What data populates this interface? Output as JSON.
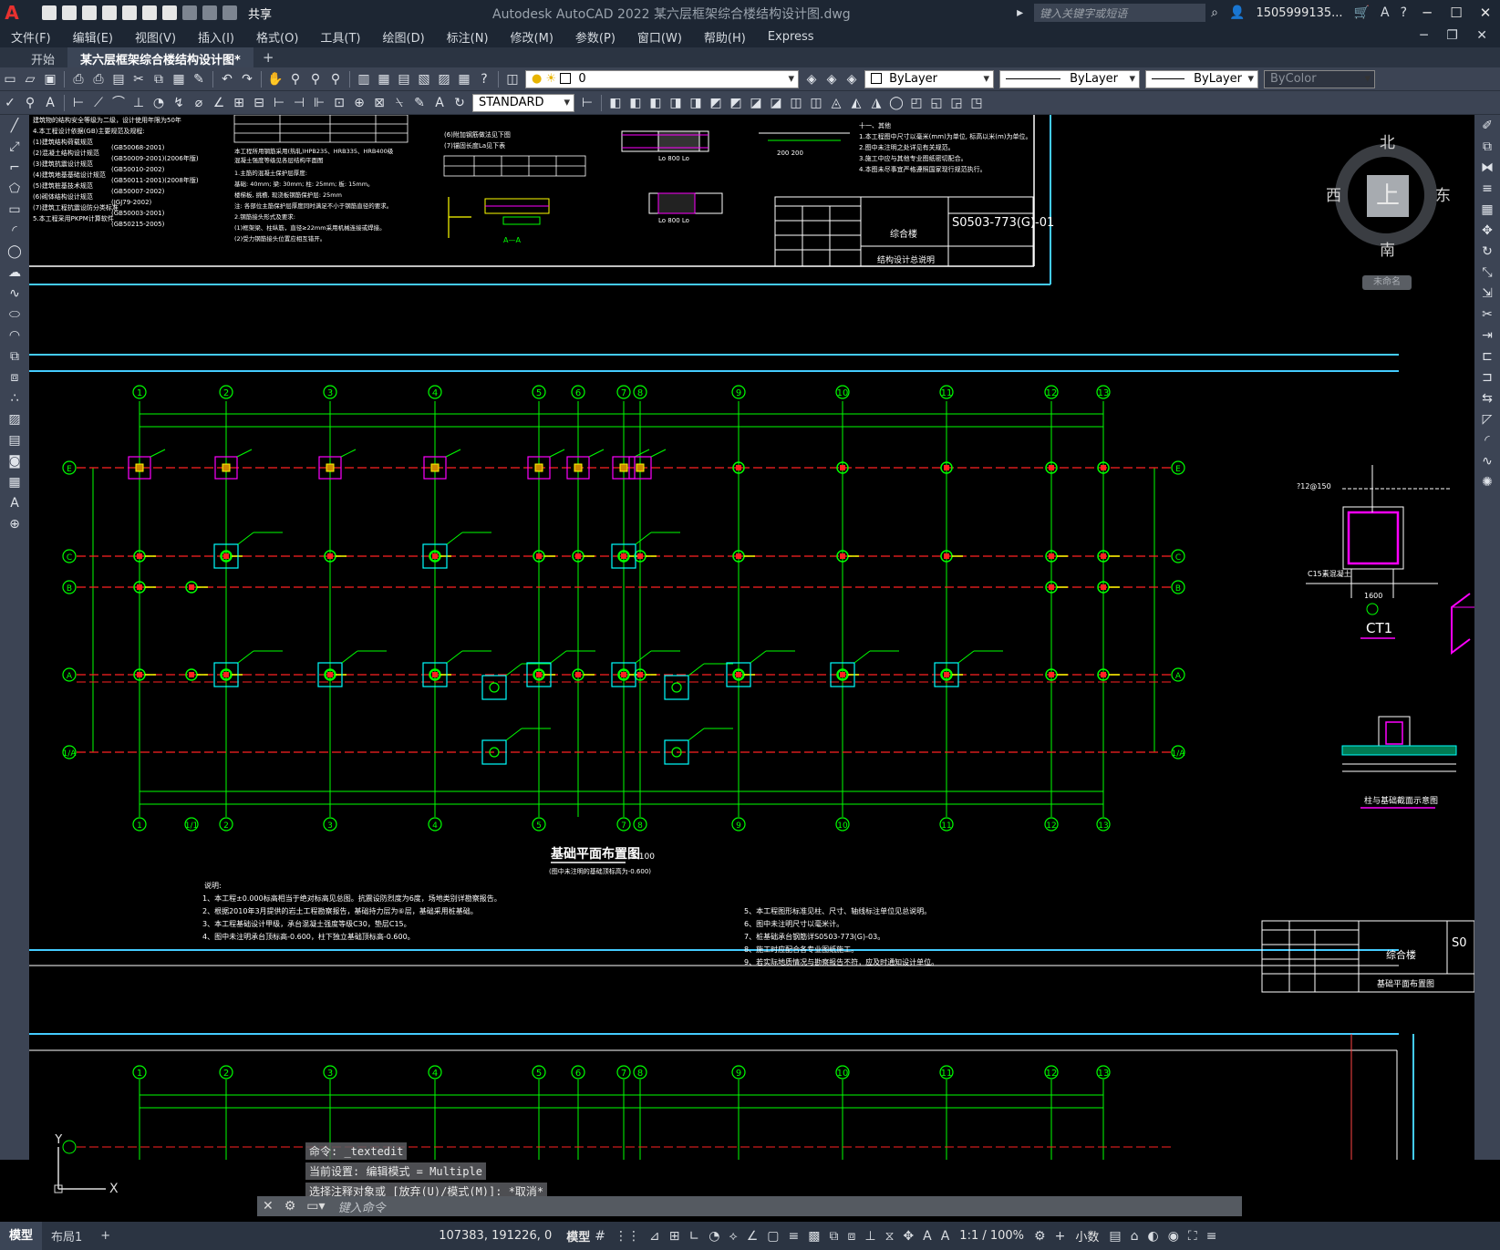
{
  "titlebar": {
    "app_title": "Autodesk AutoCAD 2022    某六层框架综合楼结构设计图.dwg",
    "share_label": "共享",
    "search_placeholder": "键入关键字或短语",
    "user": "1505999135...",
    "icons": [
      "autocad-logo",
      "new-icon",
      "open-icon",
      "save-icon",
      "saveas-icon",
      "plot-icon",
      "undo-icon",
      "redo-icon",
      "search-icon",
      "user-icon",
      "cart-icon",
      "help-icon"
    ]
  },
  "menu": {
    "items": [
      "文件(F)",
      "编辑(E)",
      "视图(V)",
      "插入(I)",
      "格式(O)",
      "工具(T)",
      "绘图(D)",
      "标注(N)",
      "修改(M)",
      "参数(P)",
      "窗口(W)",
      "帮助(H)",
      "Express"
    ]
  },
  "tabs": {
    "start": "开始",
    "active": "某六层框架综合楼结构设计图*",
    "add": "+"
  },
  "toolbar1": {
    "layer_value": "0",
    "color_value": "ByLayer",
    "linetype_value": "ByLayer",
    "lineweight_value": "ByLayer",
    "plotstyle_value": "ByColor"
  },
  "toolbar2": {
    "textstyle_value": "STANDARD"
  },
  "drawing": {
    "plan_title": "基础平面布置图",
    "plan_scale": "1:100",
    "plan_subtitle": "(图中未注明的基础顶标高为-0.600)",
    "sheet_code": "S0503-773(G)-01",
    "project_name": "综合楼",
    "sheet_name_top": "结构设计总说明",
    "sheet_name_bottom": "基础平面布置图",
    "detail_ct1": "CT1",
    "detail_section": "柱与基础截面示意图",
    "notes_header": "说明:",
    "notes": [
      "1、本工程±0.000标高相当于绝对标高见总图。抗震设防烈度为6度，场地类别详勘察报告。",
      "2、根据2010年3月提供的岩土工程勘察报告，基础持力层为⑥层，基础采用桩基础。",
      "3、本工程基础设计甲级，承台混凝土强度等级C30，垫层C15。",
      "4、图中未注明承台顶标高-0.600，柱下独立基础顶标高-0.600。"
    ],
    "notes_right": [
      "5、本工程图形标准见柱、尺寸、轴线标注单位见总说明。",
      "6、图中未注明尺寸以毫米计。",
      "7、桩基础承台钢筋详S0503-773(G)-03。",
      "8、施工时应配合各专业图纸施工。",
      "9、若实际地质情况与勘察报告不符，应及时通知设计单位。"
    ],
    "axis_top": [
      "1",
      "2",
      "3",
      "4",
      "5",
      "6",
      "7",
      "8",
      "9",
      "10",
      "11",
      "12",
      "13"
    ],
    "axis_bottom": [
      "1",
      "1/1",
      "2",
      "3",
      "4",
      "5",
      "7",
      "8",
      "9",
      "10",
      "11",
      "12",
      "13"
    ],
    "axis_rows": [
      "E",
      "C",
      "B",
      "A",
      "2/A",
      "1/A"
    ]
  },
  "viewcube": {
    "north": "北",
    "south": "南",
    "east": "东",
    "west": "西",
    "face": "上",
    "named_view": "未命名"
  },
  "command": {
    "history": [
      "命令:  _textedit",
      "当前设置: 编辑模式 = Multiple",
      "选择注释对象或 [放弃(U)/模式(M)]: *取消*"
    ],
    "placeholder": "键入命令"
  },
  "ucs": {
    "x": "X",
    "y": "Y"
  },
  "statusbar": {
    "tabs": [
      "模型",
      "布局1"
    ],
    "add": "+",
    "coordinates": "107383, 191226, 0",
    "model_label": "模型",
    "annotation_scale": "1:1 / 100%",
    "units": "小数"
  }
}
